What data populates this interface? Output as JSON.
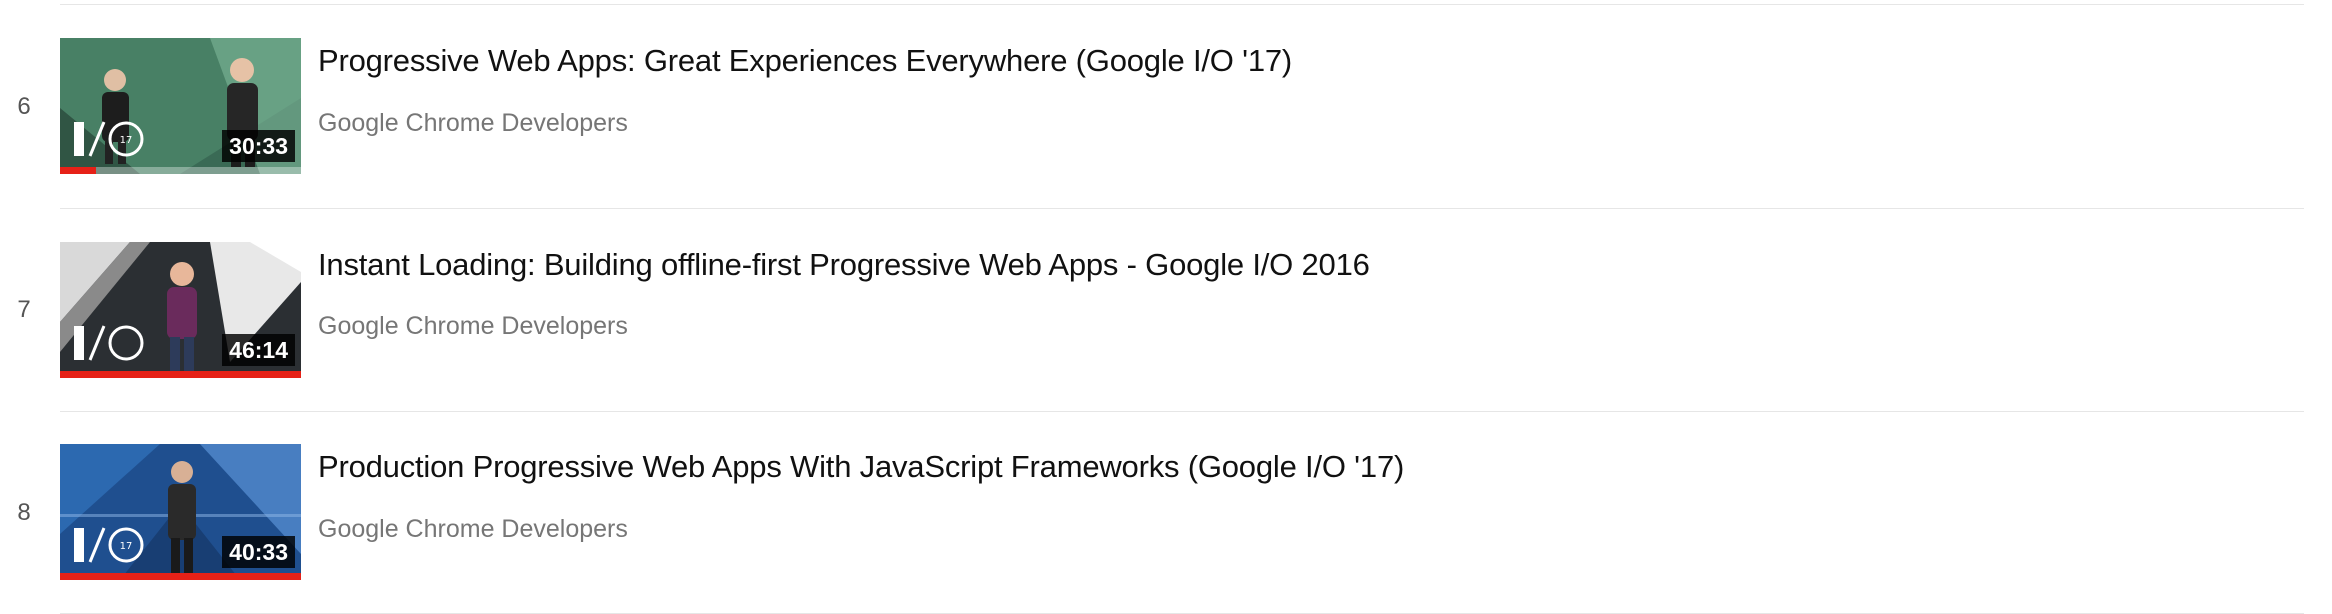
{
  "playlist": {
    "items": [
      {
        "index": "6",
        "title": "Progressive Web Apps: Great Experiences Everywhere (Google I/O '17)",
        "channel": "Google Chrome Developers",
        "duration": "30:33",
        "watched_fraction": 0.15,
        "thumbnail_color": "#3a6a55"
      },
      {
        "index": "7",
        "title": "Instant Loading: Building offline-first Progressive Web Apps - Google I/O 2016",
        "channel": "Google Chrome Developers",
        "duration": "46:14",
        "watched_fraction": 1.0,
        "thumbnail_color": "#2b2f33"
      },
      {
        "index": "8",
        "title": "Production Progressive Web Apps With JavaScript Frameworks (Google I/O '17)",
        "channel": "Google Chrome Developers",
        "duration": "40:33",
        "watched_fraction": 1.0,
        "thumbnail_color": "#1f4f8f"
      }
    ]
  },
  "colors": {
    "progress": "#e62117",
    "title": "#111111",
    "channel": "#767676",
    "divider": "#e6e6e6"
  }
}
